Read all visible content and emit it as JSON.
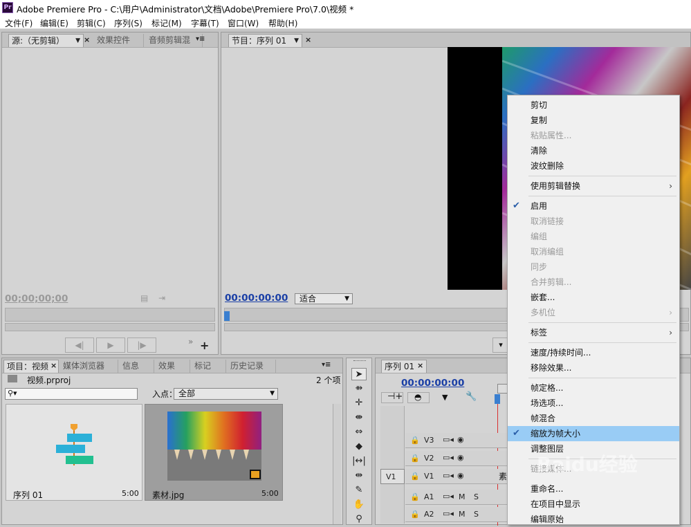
{
  "window": {
    "title": "Adobe Premiere Pro - C:\\用户\\Administrator\\文档\\Adobe\\Premiere Pro\\7.0\\视频 *",
    "icon_text": "Pr"
  },
  "menubar": [
    "文件(F)",
    "编辑(E)",
    "剪辑(C)",
    "序列(S)",
    "标记(M)",
    "字幕(T)",
    "窗口(W)",
    "帮助(H)"
  ],
  "source_panel": {
    "tabs": [
      "源:（无剪辑）",
      "效果控件",
      "音频剪辑混"
    ],
    "timecode": "00;00;00;00"
  },
  "program_panel": {
    "tab": "节目：序列 01",
    "timecode": "00:00:00:00",
    "fit": "适合"
  },
  "project_panel": {
    "tabs": [
      "项目：视频",
      "媒体浏览器",
      "信息",
      "效果",
      "标记",
      "历史记录"
    ],
    "project_file": "视频.prproj",
    "item_count": "2 个项",
    "inpoint_label": "入点：",
    "inpoint_value": "全部",
    "items": [
      {
        "name": "序列 01",
        "duration": "5:00"
      },
      {
        "name": "素材.jpg",
        "duration": "5:00"
      }
    ]
  },
  "timeline_panel": {
    "tab": "序列 01",
    "timecode": "00:00:00:00",
    "video_tracks": [
      "V3",
      "V2",
      "V1"
    ],
    "audio_tracks": [
      "A1",
      "A2"
    ],
    "source_patch": "V1",
    "mute": "M",
    "solo": "S",
    "clip_label": "素"
  },
  "context_menu": {
    "items": [
      {
        "label": "剪切",
        "disabled": false
      },
      {
        "label": "复制",
        "disabled": false
      },
      {
        "label": "粘贴属性...",
        "disabled": true
      },
      {
        "label": "清除",
        "disabled": false
      },
      {
        "label": "波纹删除",
        "disabled": false
      },
      {
        "label": "使用剪辑替换",
        "disabled": false,
        "submenu": true
      },
      {
        "label": "启用",
        "disabled": false,
        "checked": true
      },
      {
        "label": "取消链接",
        "disabled": true
      },
      {
        "label": "编组",
        "disabled": true
      },
      {
        "label": "取消编组",
        "disabled": true
      },
      {
        "label": "同步",
        "disabled": true
      },
      {
        "label": "合并剪辑...",
        "disabled": true
      },
      {
        "label": "嵌套...",
        "disabled": false
      },
      {
        "label": "多机位",
        "disabled": true,
        "submenu": true
      },
      {
        "label": "标签",
        "disabled": false,
        "submenu": true
      },
      {
        "label": "速度/持续时间...",
        "disabled": false
      },
      {
        "label": "移除效果...",
        "disabled": false
      },
      {
        "label": "帧定格...",
        "disabled": false
      },
      {
        "label": "场选项...",
        "disabled": false
      },
      {
        "label": "帧混合",
        "disabled": false
      },
      {
        "label": "缩放为帧大小",
        "disabled": false,
        "checked": true,
        "highlighted": true
      },
      {
        "label": "调整图层",
        "disabled": false
      },
      {
        "label": "链接媒体...",
        "disabled": true
      },
      {
        "label": "重命名...",
        "disabled": false
      },
      {
        "label": "在项目中显示",
        "disabled": false
      },
      {
        "label": "编辑原始",
        "disabled": false
      }
    ]
  },
  "watermark": "Baidu经验",
  "colors": {
    "timecode_blue": "#1a3fa6",
    "playhead_red": "#d83030",
    "menu_highlight": "#99ccf5"
  }
}
